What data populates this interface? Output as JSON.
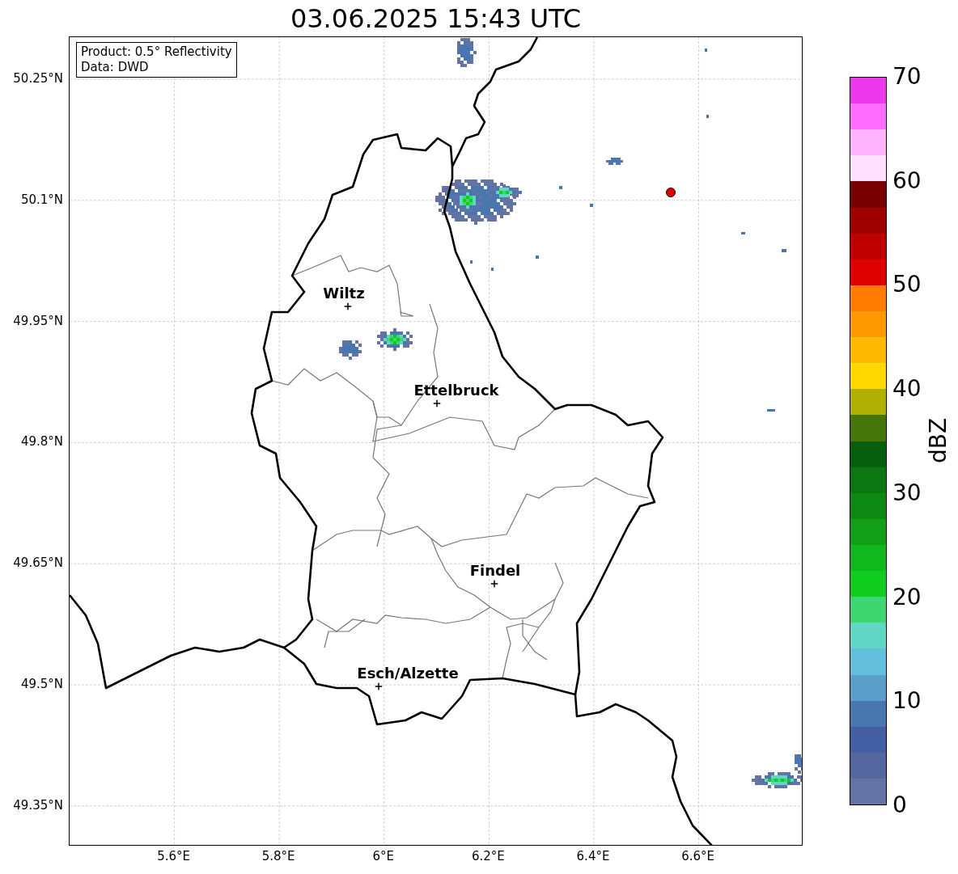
{
  "title": "03.06.2025 15:43 UTC",
  "info_box": {
    "lines": [
      "Product: 0.5° Reflectivity",
      "Data: DWD"
    ]
  },
  "y_ticks": [
    "50.25°N",
    "50.1°N",
    "49.95°N",
    "49.8°N",
    "49.65°N",
    "49.5°N",
    "49.35°N"
  ],
  "x_ticks": [
    "5.6°E",
    "5.8°E",
    "6°E",
    "6.2°E",
    "6.4°E",
    "6.6°E"
  ],
  "cities": [
    {
      "name": "Wiltz"
    },
    {
      "name": "Ettelbruck"
    },
    {
      "name": "Findel"
    },
    {
      "name": "Esch/Alzette"
    }
  ],
  "colorbar": {
    "label": "dBZ",
    "ticks": [
      "70",
      "60",
      "50",
      "40",
      "30",
      "20",
      "10",
      "0"
    ],
    "bands": [
      {
        "color": "#ec38ec"
      },
      {
        "color": "#ff6cff"
      },
      {
        "color": "#ffb4ff"
      },
      {
        "color": "#ffe0ff"
      },
      {
        "color": "#780000"
      },
      {
        "color": "#a00000"
      },
      {
        "color": "#c00000"
      },
      {
        "color": "#e00000"
      },
      {
        "color": "#ff7c00"
      },
      {
        "color": "#ff9800"
      },
      {
        "color": "#ffb800"
      },
      {
        "color": "#ffd800"
      },
      {
        "color": "#b0b004"
      },
      {
        "color": "#44760a"
      },
      {
        "color": "#075e0e"
      },
      {
        "color": "#0b7612"
      },
      {
        "color": "#0e8a14"
      },
      {
        "color": "#109f16"
      },
      {
        "color": "#10b81e"
      },
      {
        "color": "#10cc1e"
      },
      {
        "color": "#3dd670"
      },
      {
        "color": "#62d6c4"
      },
      {
        "color": "#64bfdc"
      },
      {
        "color": "#5a9fc9"
      },
      {
        "color": "#4a76af"
      },
      {
        "color": "#435ea3"
      },
      {
        "color": "#54679f"
      },
      {
        "color": "#6373a4"
      }
    ]
  }
}
